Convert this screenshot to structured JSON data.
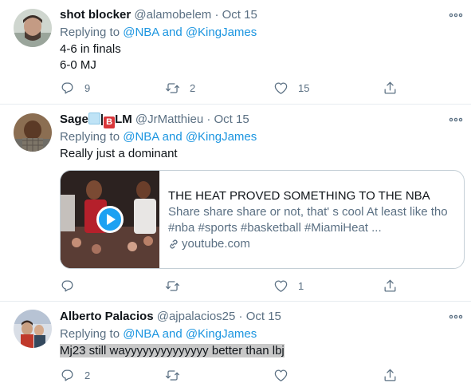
{
  "tweets": [
    {
      "display_name": "shot blocker",
      "handle": "@alamobelem",
      "separator": "·",
      "time": "Oct 15",
      "replying_prefix": "Replying to",
      "replying_to": "@NBA and @KingJames",
      "text_lines": [
        "4-6 in finals",
        "6-0 MJ"
      ],
      "replies": "9",
      "retweets": "2",
      "likes": "15"
    },
    {
      "display_name_prefix": "Sage",
      "display_name_suffix": "LM",
      "name_separator": "|",
      "flag_letter": "B",
      "handle": "@JrMatthieu",
      "separator": "·",
      "time": "Oct 15",
      "replying_prefix": "Replying to",
      "replying_to": "@NBA and @KingJames",
      "text": "Really just a dominant",
      "card": {
        "title": "THE HEAT PROVED SOMETHING TO THE NBA",
        "description": "Share share share or not, that' s cool At least like tho #nba #sports #basketball #MiamiHeat ...",
        "domain": "youtube.com"
      },
      "replies": "",
      "retweets": "",
      "likes": "1"
    },
    {
      "display_name": "Alberto Palacios",
      "handle": "@ajpalacios25",
      "separator": "·",
      "time": "Oct 15",
      "replying_prefix": "Replying to",
      "replying_to": "@NBA and @KingJames",
      "text": "Mj23 still wayyyyyyyyyyyyyy better than lbj",
      "replies": "2",
      "retweets": "",
      "likes": ""
    }
  ],
  "icons": {
    "more": "more-icon",
    "reply": "reply-icon",
    "retweet": "retweet-icon",
    "like": "like-icon",
    "share": "share-icon",
    "play": "play-icon",
    "link": "link-icon",
    "ice": "ice-cube-icon"
  },
  "colors": {
    "link": "#1b95e0",
    "secondary_text": "#5b7083",
    "primary_text": "#0f1419",
    "divider": "#e6ecf0",
    "play_button": "#1da1f2",
    "flag": "#d9373b"
  }
}
